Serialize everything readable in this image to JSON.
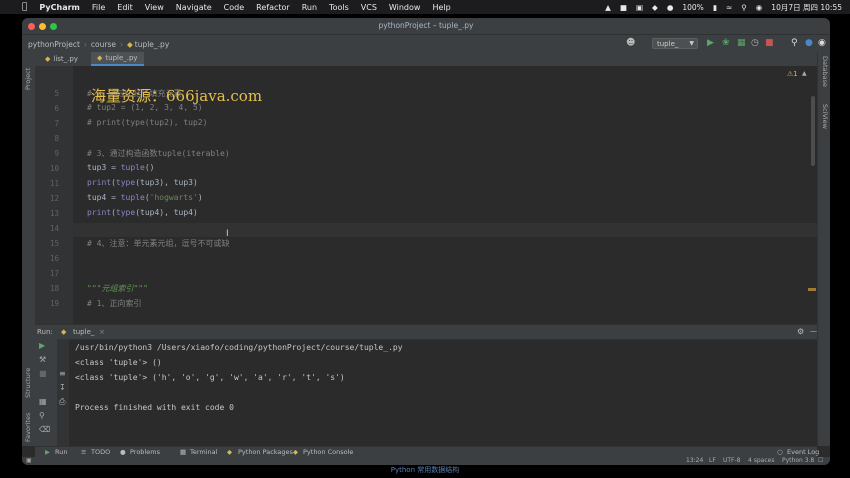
{
  "menubar": {
    "app_name": "PyCharm",
    "items": [
      "File",
      "Edit",
      "View",
      "Navigate",
      "Code",
      "Refactor",
      "Run",
      "Tools",
      "VCS",
      "Window",
      "Help"
    ],
    "battery": "100%",
    "datetime": "10月7日 周四  10:55"
  },
  "window": {
    "title": "pythonProject – tuple_.py",
    "breadcrumbs": [
      "pythonProject",
      "course",
      "tuple_.py"
    ],
    "run_config": "tuple_"
  },
  "sidebars": {
    "left": [
      "Project",
      "Structure",
      "Favorites"
    ],
    "right": [
      "Database",
      "SciView"
    ]
  },
  "tabs": [
    {
      "label": "list_.py",
      "active": false
    },
    {
      "label": "tuple_.py",
      "active": true
    }
  ],
  "editor": {
    "warning_count": "1",
    "lines": [
      {
        "n": "5",
        "text": "# 2、通过小括号填充元素",
        "kind": "cm"
      },
      {
        "n": "6",
        "text": "# tup2 = (1, 2, 3, 4, 5)",
        "kind": "cm"
      },
      {
        "n": "7",
        "text": "# print(type(tup2), tup2)",
        "kind": "cm"
      },
      {
        "n": "8",
        "text": "",
        "kind": "plain"
      },
      {
        "n": "9",
        "text": "# 3、通过构造函数tuple(iterable)",
        "kind": "cm"
      },
      {
        "n": "10",
        "text": "tup3 = tuple()",
        "kind": "code"
      },
      {
        "n": "11",
        "text": "print(type(tup3), tup3)",
        "kind": "code"
      },
      {
        "n": "12",
        "text": "tup4 = tuple('hogwarts')",
        "kind": "code"
      },
      {
        "n": "13",
        "text": "print(type(tup4), tup4)",
        "kind": "code"
      },
      {
        "n": "14",
        "text": "",
        "kind": "plain"
      },
      {
        "n": "15",
        "text": "# 4、注意：单元素元组，逗号不可或缺",
        "kind": "cm"
      },
      {
        "n": "16",
        "text": "",
        "kind": "plain"
      },
      {
        "n": "17",
        "text": "",
        "kind": "plain"
      },
      {
        "n": "18",
        "text": "\"\"\"元组索引\"\"\"",
        "kind": "doc"
      },
      {
        "n": "19",
        "text": "# 1、正向索引",
        "kind": "cm"
      }
    ]
  },
  "watermark": "海量资源：666java.com",
  "run": {
    "label": "Run:",
    "tab": "tuple_",
    "output": [
      "/usr/bin/python3 /Users/xiaofo/coding/pythonProject/course/tuple_.py",
      "<class 'tuple'> ()",
      "<class 'tuple'> ('h', 'o', 'g', 'w', 'a', 'r', 't', 's')",
      "",
      "Process finished with exit code 0"
    ]
  },
  "bottom_tools": [
    "Run",
    "TODO",
    "Problems",
    "Terminal",
    "Python Packages",
    "Python Console"
  ],
  "event_log": "Event Log",
  "status": {
    "position": "13:24",
    "line_sep": "LF",
    "encoding": "UTF-8",
    "indent": "4 spaces",
    "interpreter": "Python 3.8"
  },
  "caption": "Python 常用数据结构",
  "colors": {
    "editor_bg": "#2b2b2b",
    "panel_bg": "#3c3f41",
    "comment": "#808080",
    "string": "#6a8759",
    "builtin": "#8888c6",
    "watermark": "#e6c04a",
    "run_green": "#59a869"
  }
}
